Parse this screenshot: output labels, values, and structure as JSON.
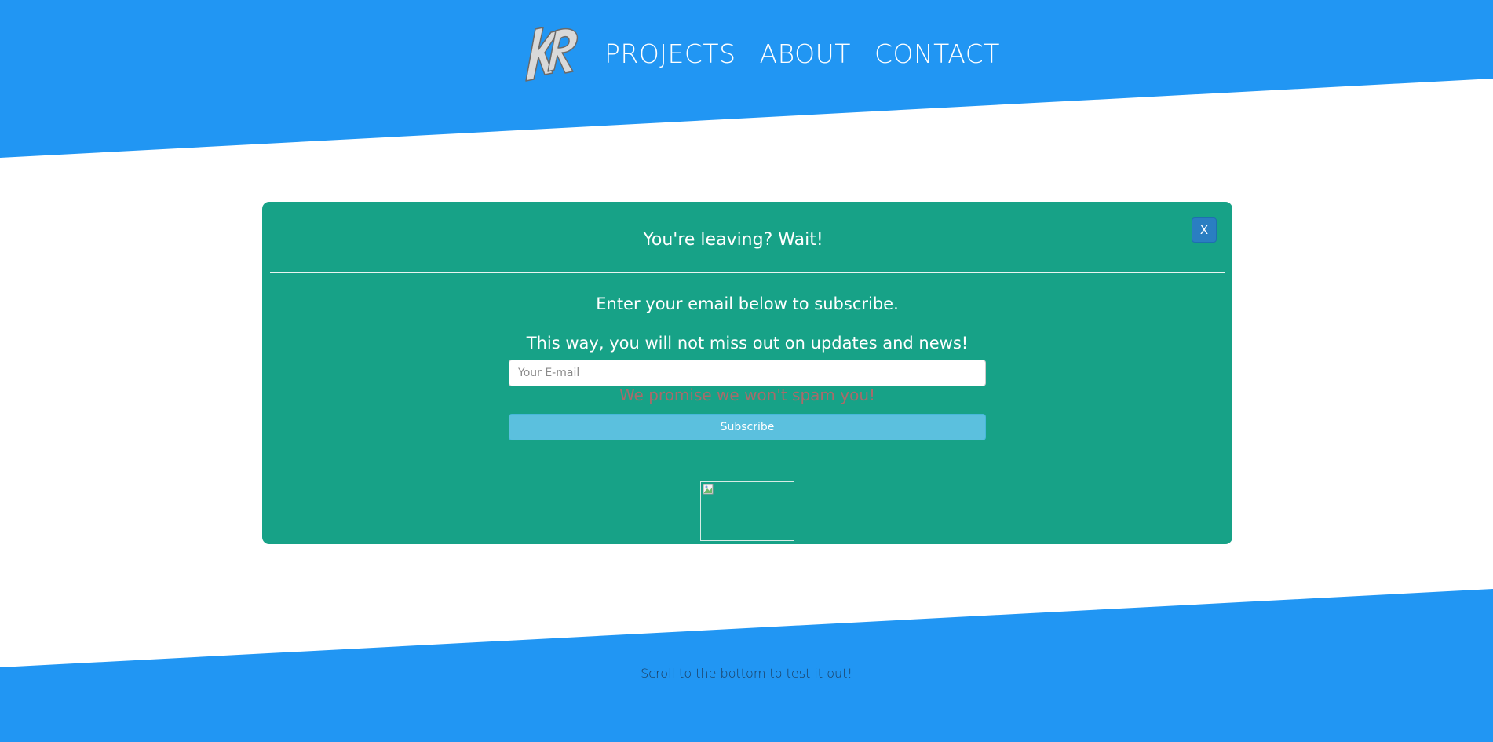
{
  "nav": {
    "logo_text": "KR",
    "links": [
      {
        "label": "PROJECTS"
      },
      {
        "label": "ABOUT"
      },
      {
        "label": "CONTACT"
      }
    ]
  },
  "modal": {
    "close_label": "X",
    "title": "You're leaving? Wait!",
    "line1": "Enter your email below to subscribe.",
    "line2": "This way, you will not miss out on updates and news!",
    "email_placeholder": "Your E-mail",
    "promise": "We promise we won't spam you!",
    "subscribe_label": "Subscribe",
    "image_icon": "broken-image-icon"
  },
  "footer": {
    "text": "Scroll to the bottom to test it out!"
  },
  "colors": {
    "header_blue": "#2196f3",
    "modal_green": "#17a287",
    "subscribe_blue": "#5bc0de",
    "close_blue": "#2a7ec2"
  }
}
